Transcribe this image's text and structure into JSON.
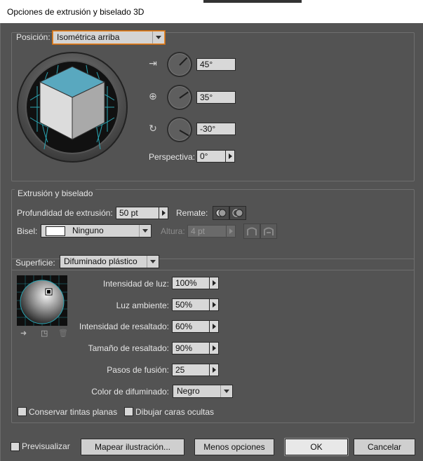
{
  "window": {
    "title": "Opciones de extrusión y biselado 3D"
  },
  "position": {
    "label": "Posición:",
    "preset": "Isométrica arriba",
    "rotations": [
      {
        "icon": "x-axis-rotation-icon",
        "value": "45°",
        "needle_deg": -45
      },
      {
        "icon": "y-axis-rotation-icon",
        "value": "35°",
        "needle_deg": -35
      },
      {
        "icon": "z-axis-rotation-icon",
        "value": "-30°",
        "needle_deg": 30
      }
    ],
    "perspective_label": "Perspectiva:",
    "perspective_value": "0°"
  },
  "extrude": {
    "title": "Extrusión y biselado",
    "depth_label": "Profundidad de extrusión:",
    "depth_value": "50 pt",
    "cap_label": "Remate:",
    "bevel_label": "Bisel:",
    "bevel_value": "Ninguno",
    "height_label": "Altura:",
    "height_value": "4 pt"
  },
  "surface": {
    "label": "Superficie:",
    "value": "Difuminado plástico",
    "rows": [
      {
        "label": "Intensidad de luz:",
        "value": "100%"
      },
      {
        "label": "Luz ambiente:",
        "value": "50%"
      },
      {
        "label": "Intensidad de resaltado:",
        "value": "60%"
      },
      {
        "label": "Tamaño de resaltado:",
        "value": "90%"
      },
      {
        "label": "Pasos de fusión:",
        "value": "25"
      }
    ],
    "shading_color_label": "Color de difuminado:",
    "shading_color_value": "Negro",
    "preserve_spot": "Conservar tintas planas",
    "draw_hidden": "Dibujar caras ocultas"
  },
  "footer": {
    "preview": "Previsualizar",
    "map_art": "Mapear ilustración...",
    "fewer_options": "Menos opciones",
    "ok": "OK",
    "cancel": "Cancelar"
  },
  "colors": {
    "cube_top": "#59a8bf",
    "cube_left": "#dcdcdc",
    "cube_right": "#a9a9a9",
    "grid": "#2aa6b4",
    "focus": "#e58a2d"
  }
}
